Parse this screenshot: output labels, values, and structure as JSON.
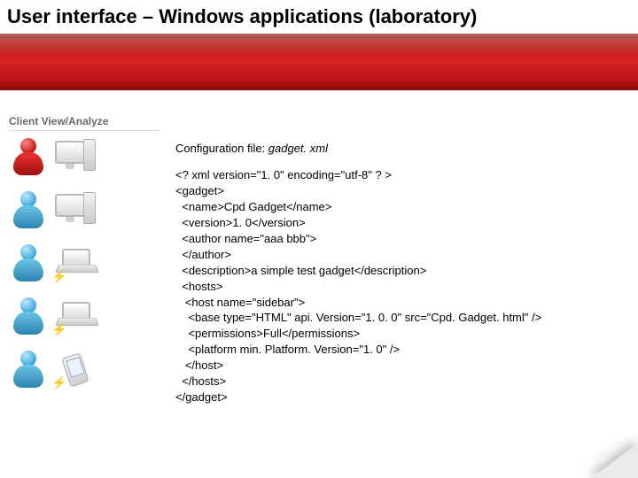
{
  "title": "User interface – Windows applications (laboratory)",
  "sidebar": {
    "heading": "Client View/Analyze",
    "rows": [
      {
        "role": "Administrator",
        "device": "pc",
        "person": "admin"
      },
      {
        "role": "User",
        "device": "pc",
        "person": "user"
      },
      {
        "role": "User",
        "device": "laptop",
        "person": "user"
      },
      {
        "role": "User",
        "device": "laptop",
        "person": "user"
      },
      {
        "role": "User",
        "device": "pda",
        "person": "user"
      }
    ]
  },
  "config": {
    "label_prefix": "Configuration file: ",
    "filename": "gadget. xml"
  },
  "code_lines": [
    "<? xml version=\"1. 0\" encoding=\"utf-8\" ? >",
    "<gadget>",
    "  <name>Cpd Gadget</name>",
    "  <version>1. 0</version>",
    "  <author name=\"aaa bbb\">",
    "  </author>",
    "  <description>a simple test gadget</description>",
    "  <hosts>",
    "   <host name=\"sidebar\">",
    "    <base type=\"HTML\" api. Version=\"1. 0. 0\" src=\"Cpd. Gadget. html\" />",
    "    <permissions>Full</permissions>",
    "    <platform min. Platform. Version=\"1. 0\" />",
    "   </host>",
    "  </hosts>",
    "</gadget>"
  ]
}
